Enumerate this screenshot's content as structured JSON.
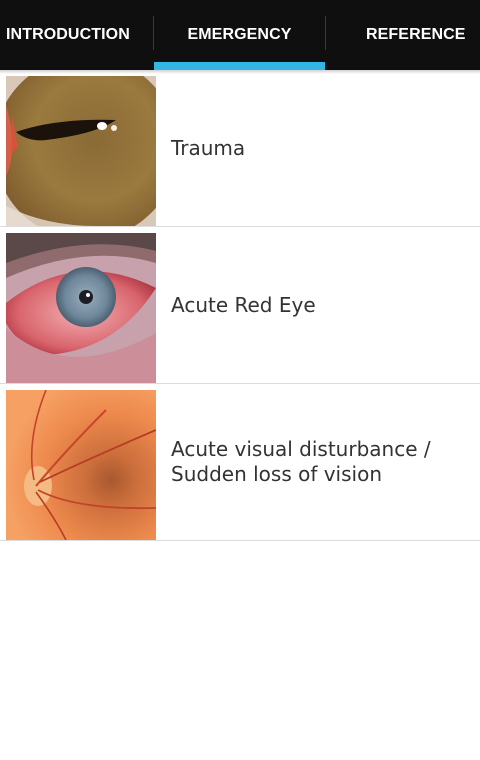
{
  "tabs": [
    {
      "label": "INTRODUCTION",
      "selected": false
    },
    {
      "label": "EMERGENCY",
      "selected": true
    },
    {
      "label": "REFERENCE",
      "selected": false
    }
  ],
  "colors": {
    "tab_bar_background": "#0f0f0f",
    "tab_indicator": "#33b5e5",
    "list_text": "#333333",
    "divider": "#dcdcdc"
  },
  "items": [
    {
      "label": "Trauma",
      "image": "eye-trauma-closeup-photo"
    },
    {
      "label": "Acute Red Eye",
      "image": "red-eye-photo"
    },
    {
      "label": "Acute visual disturbance /\nSudden loss of vision",
      "image": "retina-fundus-photo"
    }
  ]
}
